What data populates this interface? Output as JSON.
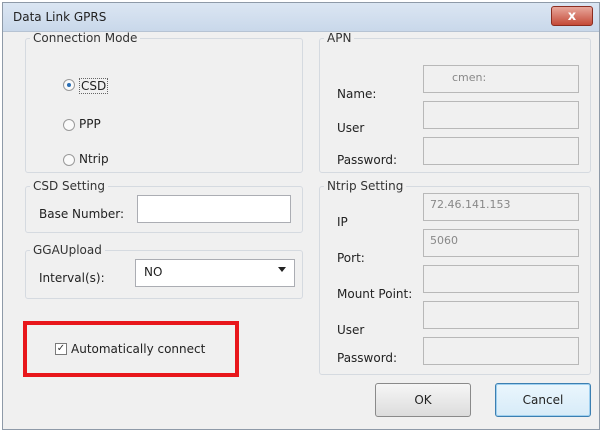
{
  "window": {
    "title": "Data Link  GPRS",
    "close_label": "x"
  },
  "connection_mode": {
    "legend": "Connection Mode",
    "options": [
      {
        "label": "CSD",
        "selected": true
      },
      {
        "label": "PPP",
        "selected": false
      },
      {
        "label": "Ntrip",
        "selected": false
      }
    ]
  },
  "apn": {
    "legend": "APN",
    "name_label": "Name:",
    "name_value": "cmen:",
    "user_label": "User",
    "user_value": "",
    "password_label": "Password:",
    "password_value": ""
  },
  "csd_setting": {
    "legend": "CSD Setting",
    "base_number_label": "Base Number:",
    "base_number_value": ""
  },
  "gga_upload": {
    "legend": "GGAUpload",
    "interval_label": "Interval(s):",
    "interval_value": "NO"
  },
  "auto_connect": {
    "label": "Automatically connect",
    "checked": true
  },
  "ntrip_setting": {
    "legend": "Ntrip Setting",
    "ip_label": "IP",
    "ip_value": "72.46.141.153",
    "port_label": "Port:",
    "port_value": "5060",
    "mount_point_label": "Mount Point:",
    "mount_point_value": "",
    "user_label": "User",
    "user_value": "",
    "password_label": "Password:",
    "password_value": ""
  },
  "buttons": {
    "ok": "OK",
    "cancel": "Cancel"
  },
  "colors": {
    "highlight": "#e8161b",
    "accent": "#3c7fb1"
  }
}
